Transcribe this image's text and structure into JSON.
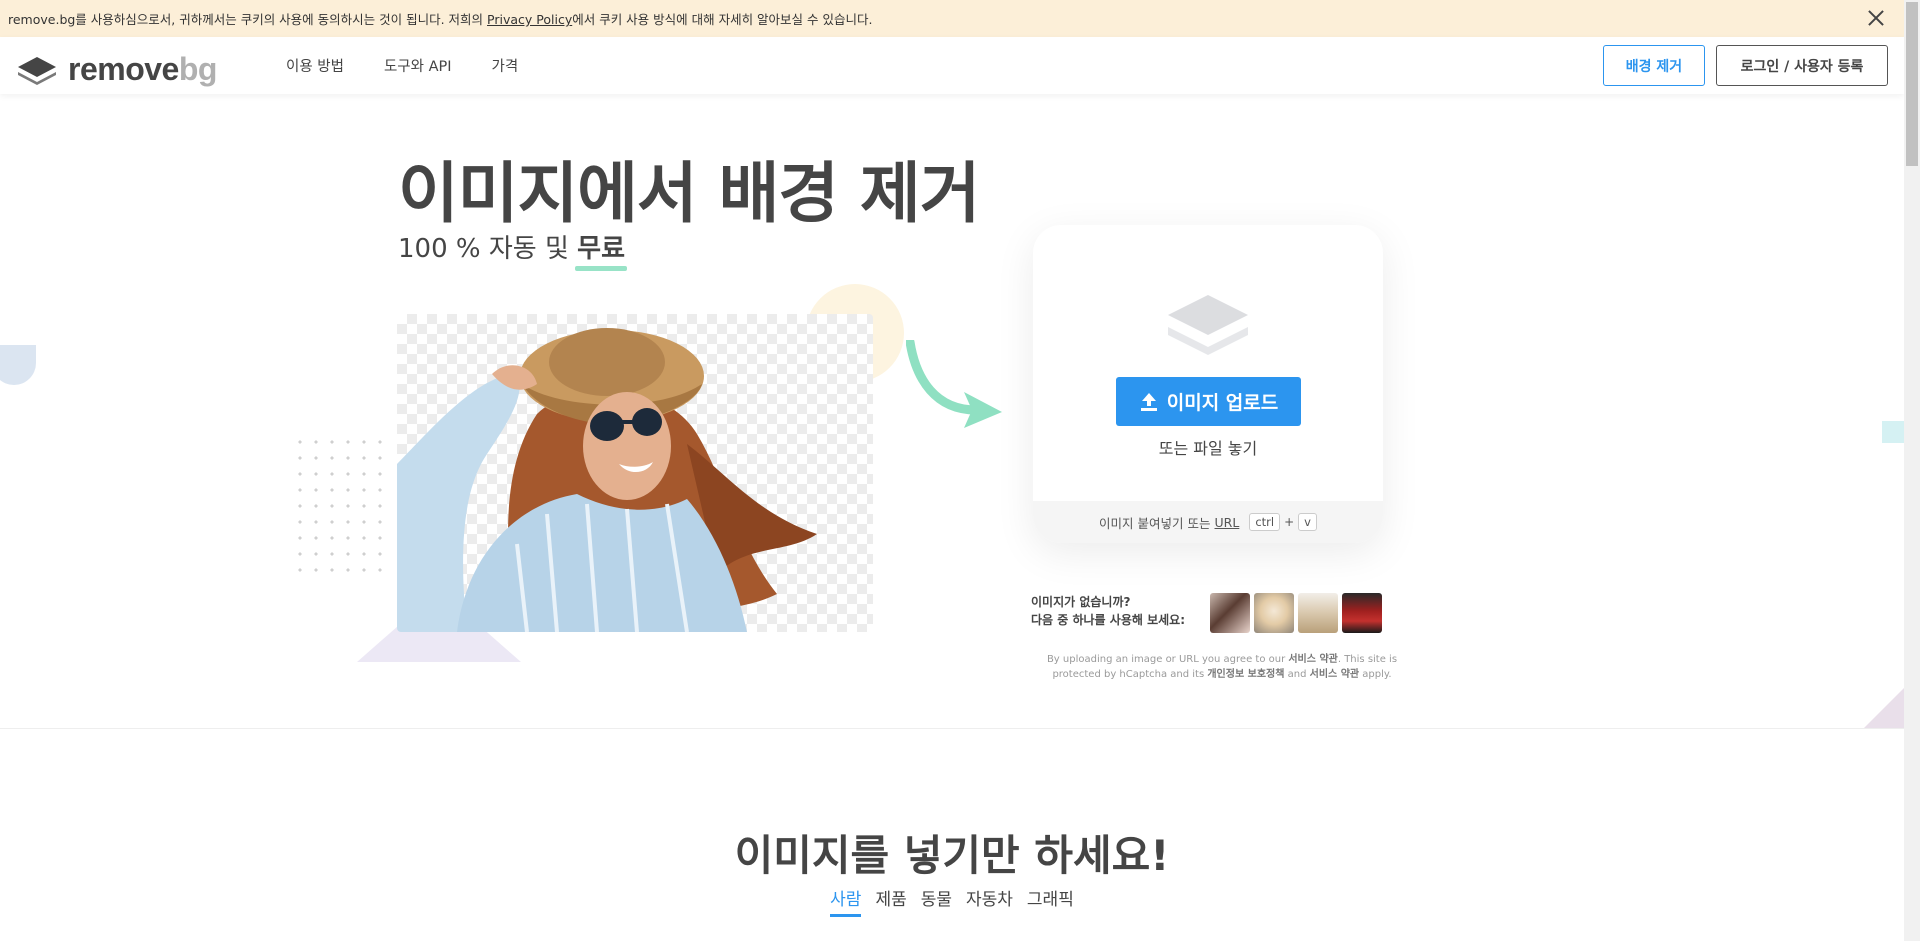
{
  "cookie": {
    "text_before": "remove.bg를 사용하심으로서, 귀하께서는 쿠키의 사용에 동의하시는 것이 됩니다. 저희의 ",
    "link": "Privacy Policy",
    "text_after": "에서 쿠키 사용 방식에 대해 자세히 알아보실 수 있습니다."
  },
  "header": {
    "logo_main": "remove",
    "logo_bg": "bg",
    "nav": [
      "이용 방법",
      "도구와 API",
      "가격"
    ],
    "remove_bg_button": "배경 제거",
    "login_button": "로그인 / 사용자 등록"
  },
  "hero": {
    "title": "이미지에서 배경 제거",
    "subtitle_prefix": "100 % 자동 및 ",
    "subtitle_free": "무료"
  },
  "upload": {
    "button": "이미지 업로드",
    "drop_text": "또는 파일 놓기",
    "paste_text": "이미지 붙여넣기 또는",
    "paste_url": "URL",
    "key_ctrl": "ctrl",
    "key_plus": "+",
    "key_v": "v"
  },
  "samples": {
    "line1": "이미지가 없습니까?",
    "line2": "다음 중 하나를 사용해 보세요:"
  },
  "legal": {
    "part1": "By uploading an image or URL you agree to our ",
    "terms": "서비스 약관",
    "part2": ". This site is protected by hCaptcha and its ",
    "privacy": "개인정보 보호정책",
    "part3": " and ",
    "terms2": "서비스 약관",
    "part4": " apply."
  },
  "section": {
    "title": "이미지를 넣기만 하세요!",
    "tabs": [
      "사람",
      "제품",
      "동물",
      "자동차",
      "그래픽"
    ]
  },
  "colors": {
    "accent": "#2c95ef",
    "cookie_bg": "#fcefd8",
    "highlight": "#98e3c7",
    "arrow": "#8fe0c2"
  }
}
